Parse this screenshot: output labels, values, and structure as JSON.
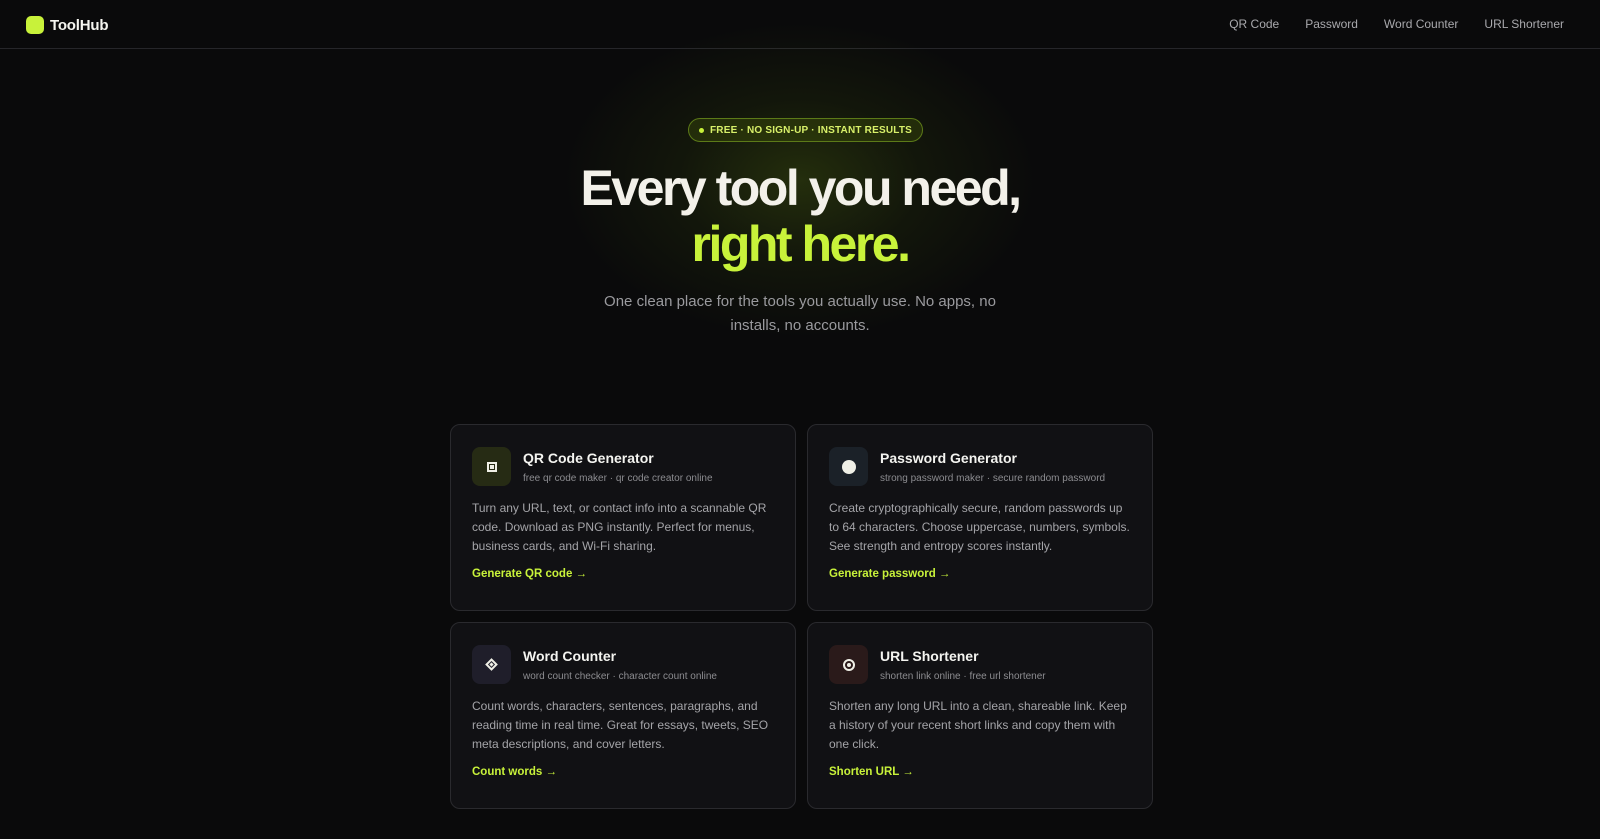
{
  "brand": {
    "name": "ToolHub"
  },
  "nav": {
    "links": [
      "QR Code",
      "Password",
      "Word Counter",
      "URL Shortener"
    ]
  },
  "hero": {
    "badge": "FREE · NO SIGN-UP · INSTANT RESULTS",
    "title_line1": "Every tool you need,",
    "title_line2": "right here.",
    "subtitle": "One clean place for the tools you actually use. No apps, no installs, no accounts."
  },
  "tools": [
    {
      "title": "QR Code Generator",
      "tags": "free qr code maker · qr code creator online",
      "description": "Turn any URL, text, or contact info into a scannable QR code. Download as PNG instantly. Perfect for menus, business cards, and Wi-Fi sharing.",
      "cta": "Generate QR code →",
      "icon": "qr-icon"
    },
    {
      "title": "Password Generator",
      "tags": "strong password maker · secure random password",
      "description": "Create cryptographically secure, random passwords up to 64 characters. Choose uppercase, numbers, symbols. See strength and entropy scores instantly.",
      "cta": "Generate password →",
      "icon": "circle-icon"
    },
    {
      "title": "Word Counter",
      "tags": "word count checker · character count online",
      "description": "Count words, characters, sentences, paragraphs, and reading time in real time. Great for essays, tweets, SEO meta descriptions, and cover letters.",
      "cta": "Count words →",
      "icon": "diamond-icon"
    },
    {
      "title": "URL Shortener",
      "tags": "shorten link online · free url shortener",
      "description": "Shorten any long URL into a clean, shareable link. Keep a history of your recent short links and copy them with one click.",
      "cta": "Shorten URL →",
      "icon": "target-icon"
    }
  ],
  "colors": {
    "accent": "#c8f23a",
    "background": "#0a0a0b",
    "card": "#111114"
  }
}
